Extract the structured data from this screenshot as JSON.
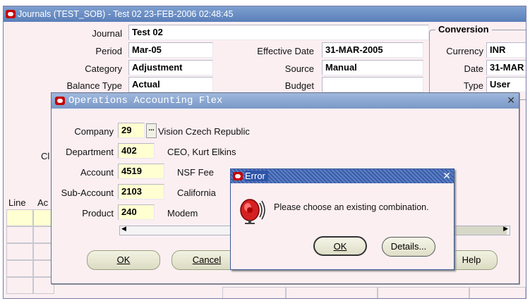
{
  "main": {
    "title": "Journals (TEST_SOB) - Test 02 23-FEB-2006 02:48:45",
    "labels": {
      "journal": "Journal",
      "period": "Period",
      "category": "Category",
      "balance_type": "Balance Type",
      "effective_date": "Effective Date",
      "source": "Source",
      "budget": "Budget",
      "cl": "Cl",
      "line": "Line",
      "ac": "Ac"
    },
    "values": {
      "journal": "Test 02",
      "period": "Mar-05",
      "category": "Adjustment",
      "balance_type": "Actual",
      "effective_date": "31-MAR-2005",
      "source": "Manual",
      "budget": ""
    },
    "conversion": {
      "title": "Conversion",
      "currency_label": "Currency",
      "currency_value": "INR",
      "date_label": "Date",
      "date_value": "31-MAR",
      "type_label": "Type",
      "type_value": "User"
    },
    "help_label": "Help"
  },
  "flex": {
    "title": "Operations Accounting Flex",
    "segments": [
      {
        "label": "Company",
        "value": "29",
        "desc": "Vision Czech Republic"
      },
      {
        "label": "Department",
        "value": "402",
        "desc": "CEO, Kurt Elkins"
      },
      {
        "label": "Account",
        "value": "4519",
        "desc": "NSF Fee"
      },
      {
        "label": "Sub-Account",
        "value": "2103",
        "desc": "California"
      },
      {
        "label": "Product",
        "value": "240",
        "desc": "Modem"
      }
    ],
    "lov_label": "...",
    "ok_label": "OK",
    "cancel_label": "Cancel"
  },
  "error": {
    "title": "Error",
    "message": "Please choose an existing combination.",
    "ok_label": "OK",
    "details_label": "Details..."
  },
  "colors": {
    "title_blue": "#5a7fba",
    "field_yellow": "#ffffd2",
    "window_pink": "#fbeff2",
    "oracle_red": "#c40000"
  }
}
